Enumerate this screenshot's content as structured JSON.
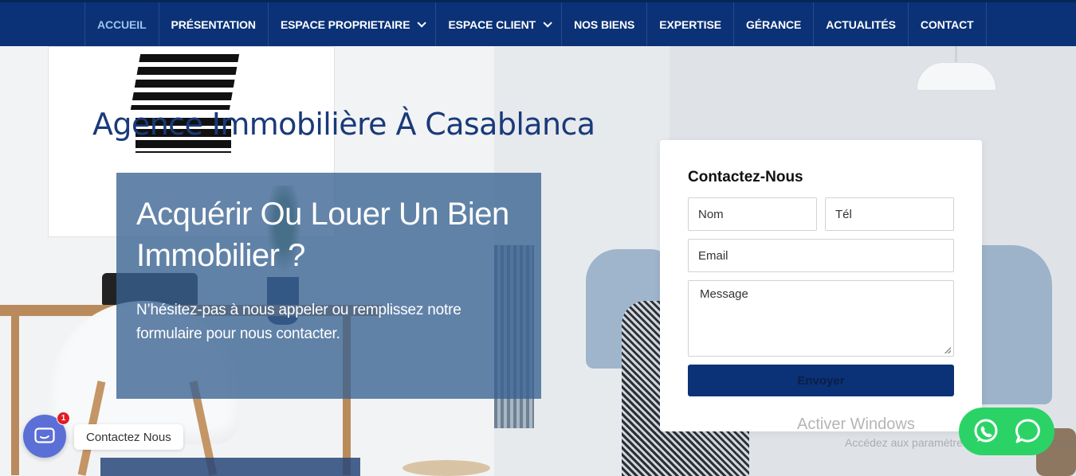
{
  "nav": {
    "items": [
      {
        "label": "ACCUEIL",
        "active": true,
        "dropdown": false
      },
      {
        "label": "PRÉSENTATION",
        "active": false,
        "dropdown": false
      },
      {
        "label": "ESPACE PROPRIETAIRE",
        "active": false,
        "dropdown": true
      },
      {
        "label": "ESPACE CLIENT",
        "active": false,
        "dropdown": true
      },
      {
        "label": "NOS BIENS",
        "active": false,
        "dropdown": false
      },
      {
        "label": "EXPERTISE",
        "active": false,
        "dropdown": false
      },
      {
        "label": "GÉRANCE",
        "active": false,
        "dropdown": false
      },
      {
        "label": "ACTUALITÉS",
        "active": false,
        "dropdown": false
      },
      {
        "label": "CONTACT",
        "active": false,
        "dropdown": false
      }
    ]
  },
  "hero": {
    "title": "Agence Immobilière À Casablanca",
    "heading": "Acquérir Ou Louer Un Bien Immobilier ?",
    "subtext": "N’hésitez-pas à nous appeler ou remplissez notre formulaire pour nous contacter."
  },
  "contact_form": {
    "title": "Contactez-Nous",
    "name_placeholder": "Nom",
    "phone_placeholder": "Tél",
    "email_placeholder": "Email",
    "message_placeholder": "Message",
    "submit_label": "Envoyer"
  },
  "watermark": {
    "title": "Activer Windows",
    "subtitle": "Accédez aux paramètres pour activer Windows."
  },
  "chat_widget": {
    "badge_count": "1",
    "label": "Contactez Nous"
  },
  "colors": {
    "nav_bg": "#0b3276",
    "nav_active": "#9fc3ea",
    "title": "#193a7a",
    "whatsapp": "#2bd366",
    "chat": "#5b6fd6"
  },
  "icons": {
    "whatsapp": "whatsapp-icon",
    "chat_bubble": "chat-bubble-icon",
    "messenger": "chat-icon"
  }
}
